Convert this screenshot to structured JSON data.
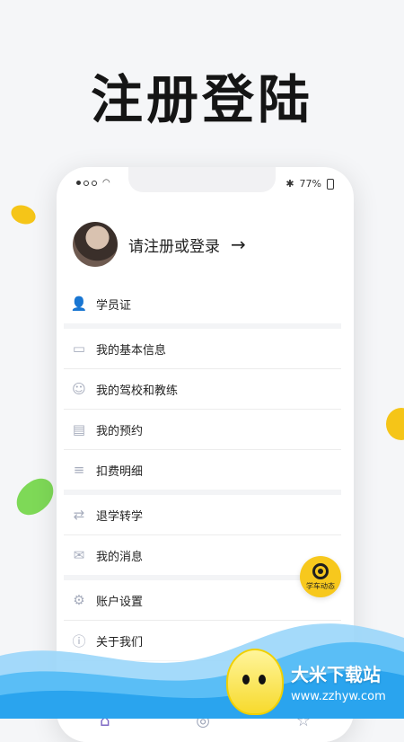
{
  "page": {
    "title": "注册登陆"
  },
  "status": {
    "battery_text": "77%"
  },
  "profile": {
    "label": "请注册或登录"
  },
  "menu": {
    "section1": {
      "items": [
        {
          "label": "学员证",
          "icon": "user-icon"
        }
      ]
    },
    "section2": {
      "items": [
        {
          "label": "我的基本信息",
          "icon": "id-card-icon"
        },
        {
          "label": "我的驾校和教练",
          "icon": "coach-icon"
        },
        {
          "label": "我的预约",
          "icon": "appointment-icon"
        },
        {
          "label": "扣费明细",
          "icon": "billing-icon"
        }
      ]
    },
    "section3": {
      "items": [
        {
          "label": "退学转学",
          "icon": "transfer-icon"
        },
        {
          "label": "我的消息",
          "icon": "message-icon"
        }
      ]
    },
    "section4": {
      "items": [
        {
          "label": "账户设置",
          "icon": "settings-icon"
        },
        {
          "label": "关于我们",
          "icon": "info-icon"
        }
      ]
    }
  },
  "fab": {
    "label": "学车动态"
  },
  "brand": {
    "name": "大米下载站",
    "url": "www.zzhyw.com"
  },
  "colors": {
    "accent_yellow": "#f7c81d",
    "wave_blue": "#3fb6f3",
    "icon_gray": "#a7adbd"
  }
}
